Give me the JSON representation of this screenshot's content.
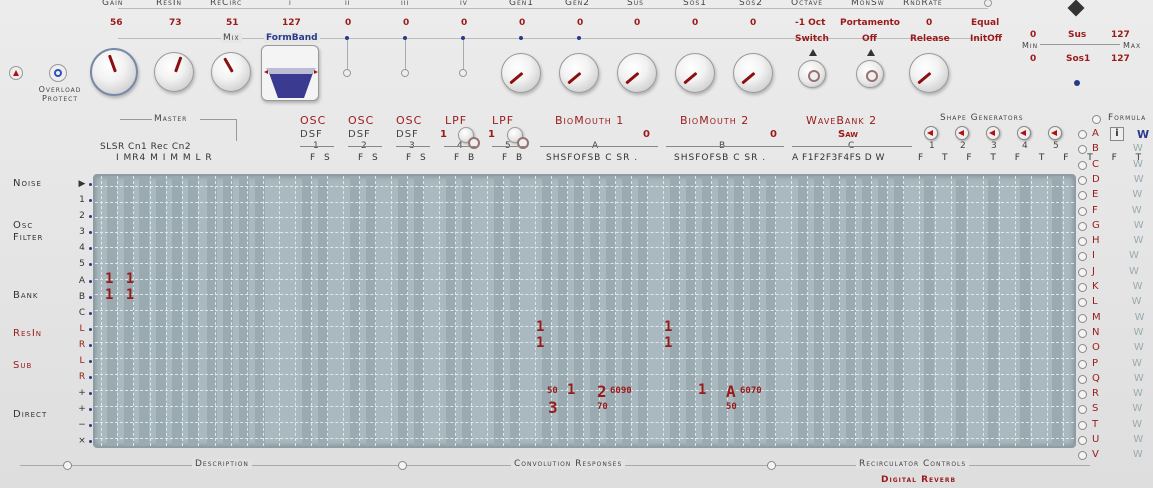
{
  "top_params": [
    {
      "label": "Gain",
      "value": "56"
    },
    {
      "label": "ResIn",
      "value": "73"
    },
    {
      "label": "ReCirc",
      "value": "51"
    },
    {
      "label": "i",
      "value": "127"
    },
    {
      "label": "ii",
      "value": "0"
    },
    {
      "label": "iii",
      "value": "0"
    },
    {
      "label": "iv",
      "value": "0"
    },
    {
      "label": "Gen1",
      "value": "0"
    },
    {
      "label": "Gen2",
      "value": "0"
    },
    {
      "label": "Sus",
      "value": "0"
    },
    {
      "label": "Sos1",
      "value": "0"
    },
    {
      "label": "Sos2",
      "value": "0"
    },
    {
      "label": "Octave",
      "value": "-1 Oct"
    },
    {
      "label": "MonSw",
      "value": "Portamento"
    },
    {
      "label": "RndRate",
      "value": "0"
    }
  ],
  "equal_label": "Equal",
  "mix_label": "Mix",
  "formband_label": "FormBand",
  "octave_switch": "Switch",
  "monsw_off": "Off",
  "release_label": "Release",
  "initoff_label": "InitOff",
  "overload_protect": "Overload Protect",
  "range_box": {
    "row1": {
      "min": "0",
      "label": "Sus",
      "max": "127"
    },
    "min_label": "Min",
    "max_label": "Max",
    "row2": {
      "min": "0",
      "label": "Sos1",
      "max": "127"
    }
  },
  "master_label": "Master",
  "section_headers": {
    "osc1": "OSC",
    "osc2": "OSC",
    "osc3": "OSC",
    "lpf1": "LPF",
    "lpf2": "LPF",
    "biomouth1": "BioMouth 1",
    "biomouth2": "BioMouth 2",
    "wavebank2": "WaveBank 2",
    "shape_generators": "Shape Generators",
    "formula": "Formula"
  },
  "sub_headers": {
    "dsf1": "DSF",
    "dsf2": "DSF",
    "dsf3": "DSF",
    "lpf1_val": "1",
    "lpf2_val": "1",
    "bm1_val": "0",
    "bm2_val": "0",
    "wb2_wave": "Saw",
    "n1": "1",
    "n2": "2",
    "n3": "3",
    "n4": "4",
    "n5": "5",
    "ga": "A",
    "gb": "B",
    "gc": "C",
    "sg1": "1",
    "sg2": "2",
    "sg3": "3",
    "sg4": "4",
    "sg5": "5"
  },
  "column_headers": [
    "SL",
    "SR",
    "Cn1",
    "I",
    "M",
    "Rec",
    "R4",
    "M",
    "Cn2",
    "I",
    "M",
    "M",
    "L",
    "R"
  ],
  "col_hdr_text": {
    "master_cols": "SLSR Cn1 Rec Cn2",
    "master_sub": "I MR4 M I M M L R",
    "osc_cols": "F S",
    "lpf_cols": "F B",
    "bm_cols": "SHSFOFSB C SR .",
    "wb_cols": "A F1F2F3F4FS D W",
    "sg_cols": "F T F T F T F T F T"
  },
  "row_labels": {
    "noise": "Noise",
    "osc_filter": "Osc Filter",
    "bank": "Bank",
    "resin": "ResIn",
    "sub": "Sub",
    "direct": "Direct"
  },
  "row_keys": [
    "▶",
    "1",
    "2",
    "3",
    "4",
    "5",
    "A",
    "B",
    "C",
    "L",
    "R",
    "L",
    "R",
    "+",
    "+",
    "−",
    "×"
  ],
  "grid_values": {
    "bank_a": "1 1",
    "bank_b": "1 1",
    "resin_l1": "1",
    "resin_r1": "1",
    "resin_l2": "1",
    "resin_r2": "1",
    "d_50": "50",
    "d_1": "1",
    "d_2": "2",
    "d_6090": "6090",
    "d_3": "3",
    "d_70": "70",
    "d_1b": "1",
    "d_a": "A",
    "d_6070": "6070",
    "d_50b": "50"
  },
  "formula_items": [
    "A",
    "B",
    "C",
    "D",
    "E",
    "F",
    "G",
    "H",
    "I",
    "J",
    "K",
    "L",
    "M",
    "N",
    "O",
    "P",
    "Q",
    "R",
    "S",
    "T",
    "U",
    "V"
  ],
  "formula_w": "W",
  "formula_info": "i",
  "bottom": {
    "description": "Description",
    "convolution": "Convolution Responses",
    "recirc": "Recirculator Controls",
    "digital_reverb": "Digital Reverb"
  }
}
